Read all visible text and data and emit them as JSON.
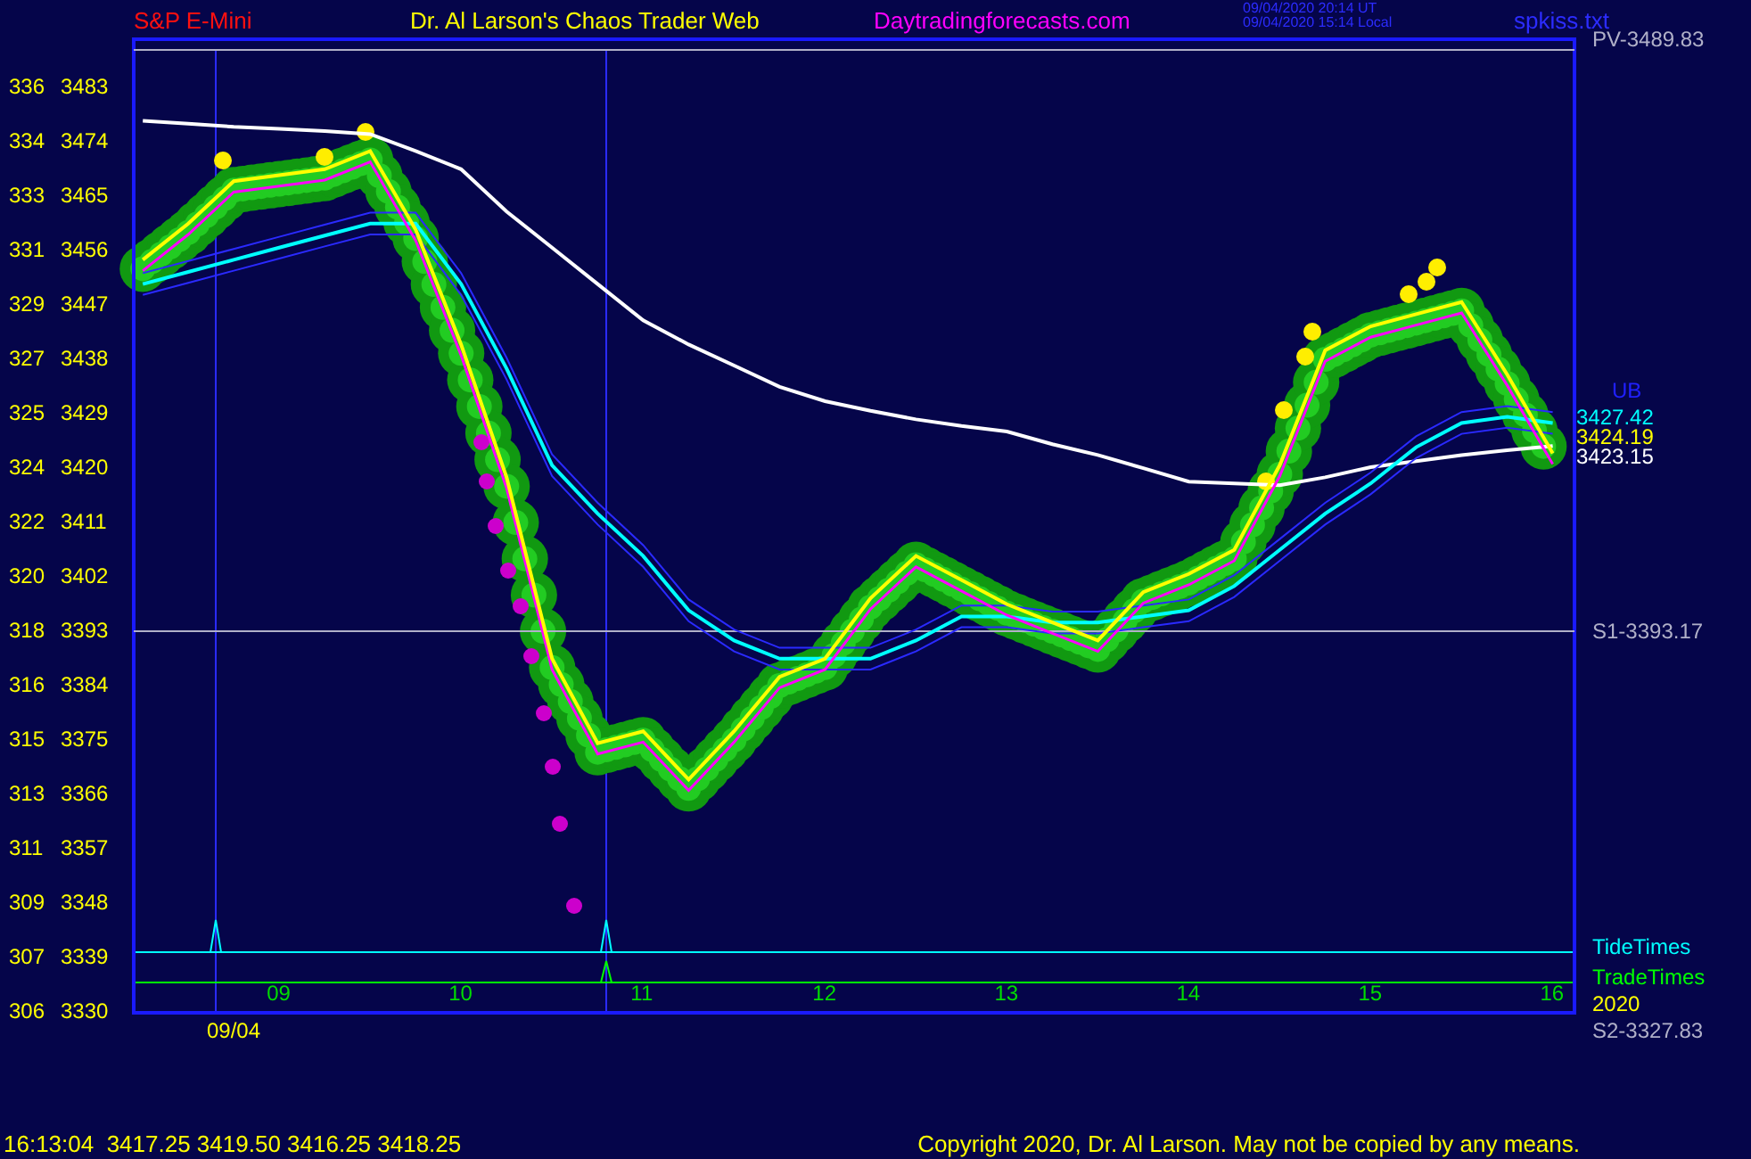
{
  "header": {
    "symbol": "S&P E-Mini",
    "title": "Dr. Al Larson's Chaos Trader Web",
    "site": "Daytradingforecasts.com",
    "timestamps": [
      "09/04/2020 20:14 UT",
      "09/04/2020 15:14 Local"
    ],
    "file": "spkiss.txt"
  },
  "chart_data": {
    "type": "line",
    "x": [
      8.25,
      8.5,
      8.75,
      9,
      9.25,
      9.5,
      9.75,
      10,
      10.25,
      10.5,
      10.75,
      11,
      11.25,
      11.5,
      11.75,
      12,
      12.25,
      12.5,
      12.75,
      13,
      13.25,
      13.5,
      13.75,
      14,
      14.25,
      14.5,
      14.75,
      15,
      15.25,
      15.5,
      15.75,
      16
    ],
    "series": [
      {
        "color": "#ffffff",
        "values": [
          3477,
          3476.5,
          3476,
          3475.7,
          3475.3,
          3474.8,
          3472,
          3469,
          3462,
          3456,
          3450,
          3444,
          3440,
          3436.5,
          3433,
          3430.6,
          3429,
          3427.6,
          3426.5,
          3425.6,
          3423.5,
          3421.7,
          3419.5,
          3417.3,
          3417,
          3416.7,
          3418,
          3419.7,
          3420.7,
          3421.7,
          3422.5,
          3423.2
        ]
      },
      {
        "color": "#2a2aff",
        "values": [
          3451.8,
          3453.8,
          3455.8,
          3457.8,
          3459.8,
          3461.8,
          3461.8,
          3451.8,
          3437.8,
          3421.8,
          3413.8,
          3406.8,
          3397.8,
          3392.8,
          3389.8,
          3389.8,
          3389.8,
          3392.8,
          3396.8,
          3396.8,
          3395.8,
          3395.8,
          3396.8,
          3397.8,
          3401.8,
          3407.8,
          3413.8,
          3418.8,
          3424.8,
          3428.8,
          3429.8,
          3428.8
        ]
      },
      {
        "color": "#2a2aff",
        "values": [
          3448.2,
          3450.2,
          3452.2,
          3454.2,
          3456.2,
          3458.2,
          3458.2,
          3448.2,
          3434.2,
          3418.2,
          3410.2,
          3403.2,
          3394.2,
          3389.2,
          3386.2,
          3386.2,
          3386.2,
          3389.2,
          3393.2,
          3393.2,
          3392.2,
          3392.2,
          3393.2,
          3394.2,
          3398.2,
          3404.2,
          3410.2,
          3415.2,
          3421.2,
          3425.2,
          3426.2,
          3425.2
        ]
      },
      {
        "color": "#00ffff",
        "values": [
          3450,
          3452,
          3454,
          3456,
          3458,
          3460,
          3460,
          3450,
          3436,
          3420,
          3412,
          3405,
          3396,
          3391,
          3388,
          3388,
          3388,
          3391,
          3395,
          3395,
          3394,
          3394,
          3395,
          3396,
          3400,
          3406,
          3412,
          3417,
          3423,
          3427,
          3428,
          3427
        ]
      },
      {
        "color": "#ff00ff",
        "values": [
          3452.2,
          3458.2,
          3465.2,
          3466.2,
          3467.2,
          3470.2,
          3457.2,
          3438.2,
          3416.2,
          3386.2,
          3372.2,
          3374.2,
          3366.2,
          3374.2,
          3383.2,
          3386.2,
          3396.2,
          3403.2,
          3399.2,
          3395.2,
          3392.2,
          3389.2,
          3397.2,
          3400.2,
          3404.2,
          3418.2,
          3437.2,
          3441.2,
          3443.2,
          3445.2,
          3433.2,
          3420.2
        ]
      },
      {
        "color": "#ffff00",
        "values": [
          3454,
          3460,
          3467,
          3468,
          3469,
          3472,
          3459,
          3440,
          3418,
          3388,
          3374,
          3376,
          3368,
          3376,
          3385,
          3388,
          3398,
          3405,
          3401,
          3397,
          3394,
          3391,
          3399,
          3402,
          3406,
          3420,
          3439,
          3443,
          3445,
          3447,
          3435,
          3422
        ]
      }
    ],
    "xticks": [
      {
        "value": 9,
        "label": "09"
      },
      {
        "value": 10,
        "label": "10"
      },
      {
        "value": 11,
        "label": "11"
      },
      {
        "value": 12,
        "label": "12"
      },
      {
        "value": 13,
        "label": "13"
      },
      {
        "value": 14,
        "label": "14"
      },
      {
        "value": 15,
        "label": "15"
      },
      {
        "value": 16,
        "label": "16"
      }
    ],
    "yticks": [
      {
        "value": 3483,
        "label": "3483"
      },
      {
        "value": 3474,
        "label": "3474"
      },
      {
        "value": 3465,
        "label": "3465"
      },
      {
        "value": 3456,
        "label": "3456"
      },
      {
        "value": 3447,
        "label": "3447"
      },
      {
        "value": 3438,
        "label": "3438"
      },
      {
        "value": 3429,
        "label": "3429"
      },
      {
        "value": 3420,
        "label": "3420"
      },
      {
        "value": 3411,
        "label": "3411"
      },
      {
        "value": 3402,
        "label": "3402"
      },
      {
        "value": 3393,
        "label": "3393"
      },
      {
        "value": 3384,
        "label": "3384"
      },
      {
        "value": 3375,
        "label": "3375"
      },
      {
        "value": 3366,
        "label": "3366"
      },
      {
        "value": 3357,
        "label": "3357"
      },
      {
        "value": 3348,
        "label": "3348"
      },
      {
        "value": 3339,
        "label": "3339"
      },
      {
        "value": 3330,
        "label": "3330"
      }
    ],
    "xlim": [
      8.2,
      16.12
    ],
    "ylim": [
      3329.4,
      3490.5
    ]
  },
  "levels": [
    {
      "label": "PV-3489.83"
    },
    {
      "label": "S1-3393.17"
    },
    {
      "label": "S2-3327.83"
    }
  ],
  "price_labels": [
    {
      "text": "UB",
      "color": "#2020ff"
    },
    {
      "text": "3427.42",
      "color": "#00ffff"
    },
    {
      "text": "3424.19",
      "color": "#ffff00"
    },
    {
      "text": "3423.15",
      "color": "#ffffff"
    }
  ],
  "secondary_axis": [
    "336",
    "334",
    "333",
    "331",
    "329",
    "327",
    "325",
    "324",
    "322",
    "320",
    "318",
    "316",
    "315",
    "313",
    "311",
    "309",
    "307",
    "306"
  ],
  "time_lines": [
    {
      "label": "TideTimes",
      "color": "#00ffff"
    },
    {
      "label": "TradeTimes",
      "color": "#00ff00"
    }
  ],
  "year_label": "2020",
  "date_label": "09/04",
  "footer": {
    "quote": "16:13:04  3417.25 3419.50 3416.25 3418.25",
    "copyright": "Copyright 2020, Dr. Al Larson. May not be copied by any means."
  }
}
